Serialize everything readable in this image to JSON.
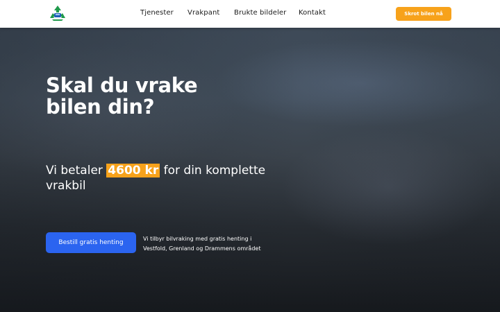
{
  "colors": {
    "accent": "#f7a21b",
    "primary_button": "#2b64f0",
    "nav_bg": "#ffffff",
    "logo_green": "#1f9a4b",
    "logo_blue": "#1e5fb8"
  },
  "header": {
    "logo_icon": "recycle-car-icon",
    "nav": [
      "Tjenester",
      "Vrakpant",
      "Brukte bildeler",
      "Kontakt"
    ],
    "cta_label": "Skrot bilen nå"
  },
  "hero": {
    "title": "Skal du vrake bilen din?",
    "subtitle_prefix": "Vi betaler ",
    "subtitle_highlight": "4600 kr",
    "subtitle_suffix": " for din komplette vrakbil",
    "button_label": "Bestill gratis henting",
    "note": "Vi tilbyr bilvraking med gratis henting i Vestfold, Grenland og Drammens området"
  }
}
